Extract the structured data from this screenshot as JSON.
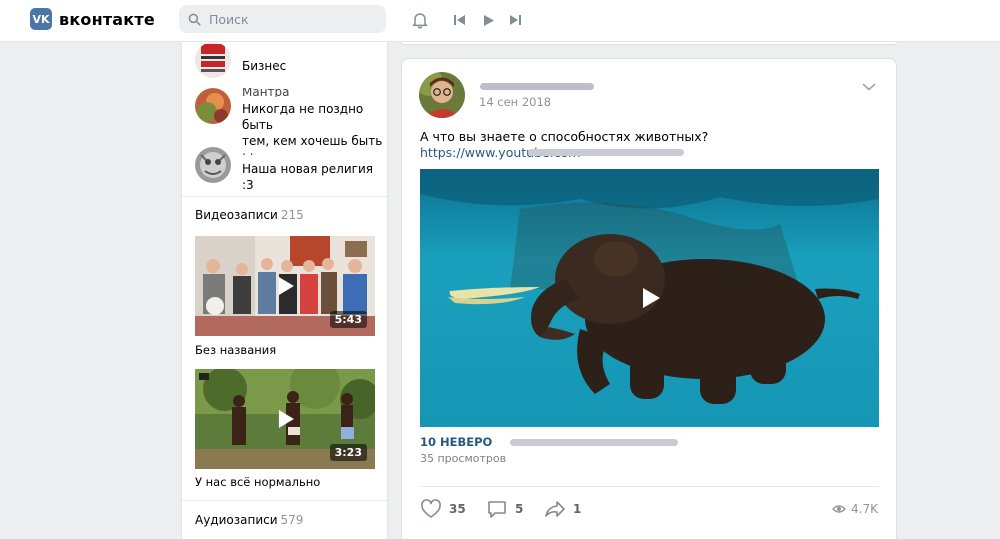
{
  "header": {
    "logo_mark": "VK",
    "logo_text": "вконтакте",
    "search_placeholder": "Поиск"
  },
  "sidebar": {
    "subscriptions": [
      {
        "name_partial": "· · · · · · · · · ·",
        "status": "Бизнес"
      },
      {
        "name_partial": "Мантра",
        "status_line1": "Никогда не поздно быть",
        "status_line2": "тем, кем хочешь быть"
      },
      {
        "name_partial": ". .",
        "status": "Наша новая религия :3"
      }
    ],
    "videos_section": {
      "title": "Видеозаписи",
      "count": "215"
    },
    "videos": [
      {
        "title": "Без названия",
        "duration": "5:43"
      },
      {
        "title": "У нас всё нормально",
        "duration": "3:23"
      }
    ],
    "audio_section": {
      "title": "Аудиозаписи",
      "count": "579"
    }
  },
  "post": {
    "date": "14 сен 2018",
    "text": "А что вы знаете о способностях животных?",
    "link": "https://www.youtube.com",
    "media_title": "10 НЕВЕРО",
    "media_views": "35 просмотров",
    "likes": "35",
    "comments": "5",
    "shares": "1",
    "views": "4.7K"
  },
  "colors": {
    "accent": "#4a76a8",
    "link": "#2a5885",
    "background": "#edeef0"
  }
}
